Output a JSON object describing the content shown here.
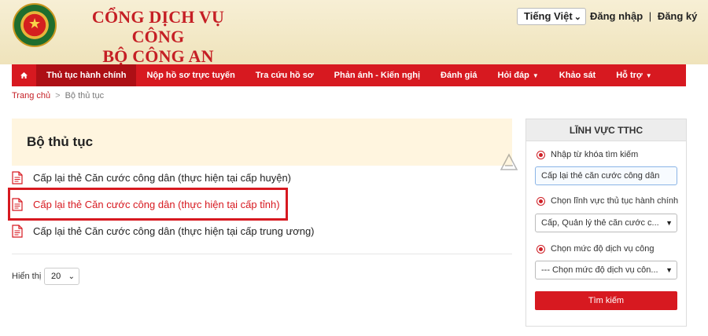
{
  "header": {
    "site_title_line1": "CỔNG DỊCH VỤ CÔNG",
    "site_title_line2": "BỘ CÔNG AN",
    "language": "Tiếng Việt",
    "login": "Đăng nhập",
    "separator": "|",
    "register": "Đăng ký"
  },
  "nav": {
    "items": [
      {
        "label": "Thủ tục hành chính"
      },
      {
        "label": "Nộp hồ sơ trực tuyến"
      },
      {
        "label": "Tra cứu hồ sơ"
      },
      {
        "label": "Phản ánh - Kiến nghị"
      },
      {
        "label": "Đánh giá"
      },
      {
        "label": "Hỏi đáp"
      },
      {
        "label": "Khảo sát"
      },
      {
        "label": "Hỗ trợ"
      }
    ]
  },
  "breadcrumb": {
    "home": "Trang chủ",
    "separator": ">",
    "current": "Bộ thủ tục"
  },
  "main": {
    "title": "Bộ thủ tục",
    "procedures": [
      {
        "label": "Cấp lại thẻ Căn cước công dân (thực hiện tại cấp huyện)"
      },
      {
        "label": "Cấp lại thẻ Căn cước công dân (thực hiện tại cấp tỉnh)"
      },
      {
        "label": "Cấp lại thẻ Căn cước công dân (thực hiện tại cấp trung ương)"
      }
    ],
    "show_label": "Hiển thị",
    "page_size": "20"
  },
  "sidebar": {
    "title": "LĨNH VỰC TTHC",
    "keyword_label": "Nhập từ khóa tìm kiếm",
    "keyword_value": "Cấp lại thẻ căn cước công dân",
    "field_label": "Chọn lĩnh vực thủ tục hành chính",
    "field_value": "Cấp, Quản lý thẻ căn cước c...",
    "level_label": "Chọn mức độ dịch vụ công",
    "level_value": "--- Chọn mức độ dịch vụ côn...",
    "search_button": "Tìm kiếm"
  },
  "colors": {
    "primary": "#d71920",
    "header_bg": "#f7efd5",
    "title_bg": "#fff5df"
  }
}
